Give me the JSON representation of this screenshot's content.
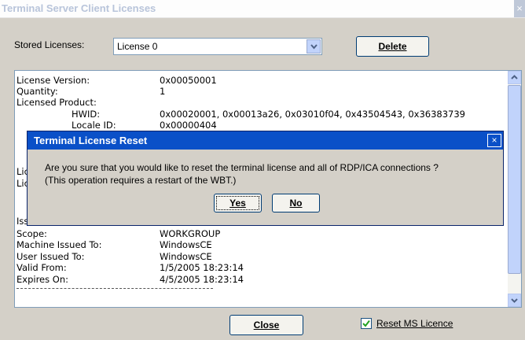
{
  "window": {
    "title": "Terminal Server Client Licenses",
    "close_glyph": "×"
  },
  "stored": {
    "label": "Stored Licenses:",
    "selected": "License 0",
    "delete_label": "Delete"
  },
  "details": [
    {
      "key": "License Version:",
      "value": "0x00050001"
    },
    {
      "key": "Quantity:",
      "value": "1"
    },
    {
      "key": "Licensed Product:",
      "value": ""
    },
    {
      "key": "HWID:",
      "value": "0x00020001, 0x00013a26, 0x03010f04, 0x43504543, 0x36383739"
    },
    {
      "key": "Locale ID:",
      "value": "0x00000404"
    },
    {
      "key": "Licer",
      "value": ""
    },
    {
      "key": "Licer",
      "value": ""
    },
    {
      "key": "Issu",
      "value": ""
    },
    {
      "key": "Scope:",
      "value": "WORKGROUP"
    },
    {
      "key": "Machine Issued To:",
      "value": "WindowsCE"
    },
    {
      "key": "User Issued To:",
      "value": "WindowsCE"
    },
    {
      "key": "Valid From:",
      "value": "1/5/2005 18:23:14"
    },
    {
      "key": "Expires On:",
      "value": "4/5/2005 18:23:14"
    }
  ],
  "dialog": {
    "title": "Terminal License Reset",
    "message_line1": "Are you sure that you would like to reset the terminal license and all of RDP/ICA connections ?",
    "message_line2": " (This operation requires a restart of the WBT.)",
    "yes_label": "Yes",
    "no_label": "No",
    "close_glyph": "×"
  },
  "footer": {
    "close_label": "Close",
    "reset_label": "Reset MS Licence",
    "reset_checked": true
  }
}
